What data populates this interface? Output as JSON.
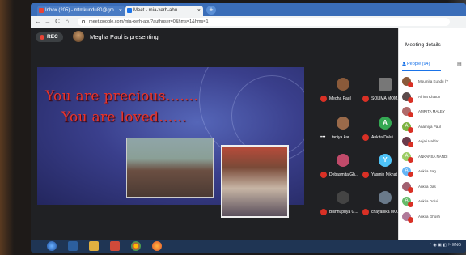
{
  "browser": {
    "tabs": [
      {
        "title": "Inbox (205) - mtmkundu80@gm",
        "favicon_color": "#ea4335"
      },
      {
        "title": "Meet - mia-xerh-abu",
        "favicon_color": "#1a73e8"
      }
    ],
    "new_tab": "+",
    "close": "×",
    "url": "meet.google.com/mia-xerh-abu?authuser=0&hms=1&hms=1",
    "nav": {
      "back": "←",
      "forward": "→",
      "reload": "C",
      "home": "⌂"
    }
  },
  "meet": {
    "rec_label": "REC",
    "presenter_text": "Megha Paul is presenting",
    "slide": {
      "line1": "You are precious…….",
      "line2": "You are loved……"
    },
    "tiles": [
      {
        "name": "Megha Paul",
        "initial": "",
        "color": "#8a5a3a"
      },
      {
        "name": "SOLIMA MOM...",
        "initial": "",
        "color": "#777"
      },
      {
        "name": "taniya kar",
        "initial": "",
        "color": "#9a6a4a"
      },
      {
        "name": "Ankita Dolui",
        "initial": "A",
        "color": "#34a853"
      },
      {
        "name": "Debasmita Gh...",
        "initial": "",
        "color": "#c04a6a"
      },
      {
        "name": "Yasmin Nikhat",
        "initial": "Y",
        "color": "#4fc3f7"
      },
      {
        "name": "Bishnupriya G...",
        "initial": "",
        "color": "#444"
      },
      {
        "name": "chayanika MO...",
        "initial": "",
        "color": "#6a7a8a"
      }
    ]
  },
  "panel": {
    "title": "Meeting details",
    "people_tab": "People (94)",
    "people": [
      {
        "name": "Moumita Kundu (Y",
        "initial": "",
        "color": "#8a5a3a"
      },
      {
        "name": "Afrina Khatun",
        "initial": "",
        "color": "#5a4a4a"
      },
      {
        "name": "AMRITA MALEY",
        "initial": "",
        "color": "#b06a6a"
      },
      {
        "name": "Anamiya Paul",
        "initial": "A",
        "color": "#7cb342"
      },
      {
        "name": "Anjali Haldar",
        "initial": "",
        "color": "#6a3a4a"
      },
      {
        "name": "ANKANSA NANDI",
        "initial": "A",
        "color": "#9ccc65"
      },
      {
        "name": "Ankita Bag",
        "initial": "A",
        "color": "#64b5f6"
      },
      {
        "name": "Ankita Das",
        "initial": "",
        "color": "#a06070"
      },
      {
        "name": "Ankita Dolui",
        "initial": "A",
        "color": "#66bb6a"
      },
      {
        "name": "Ankita Ghosh",
        "initial": "",
        "color": "#b07a9a"
      }
    ]
  },
  "taskbar": {
    "tray_text": "⌃ ◉ ▣ ◧ ⚐ ENG"
  }
}
